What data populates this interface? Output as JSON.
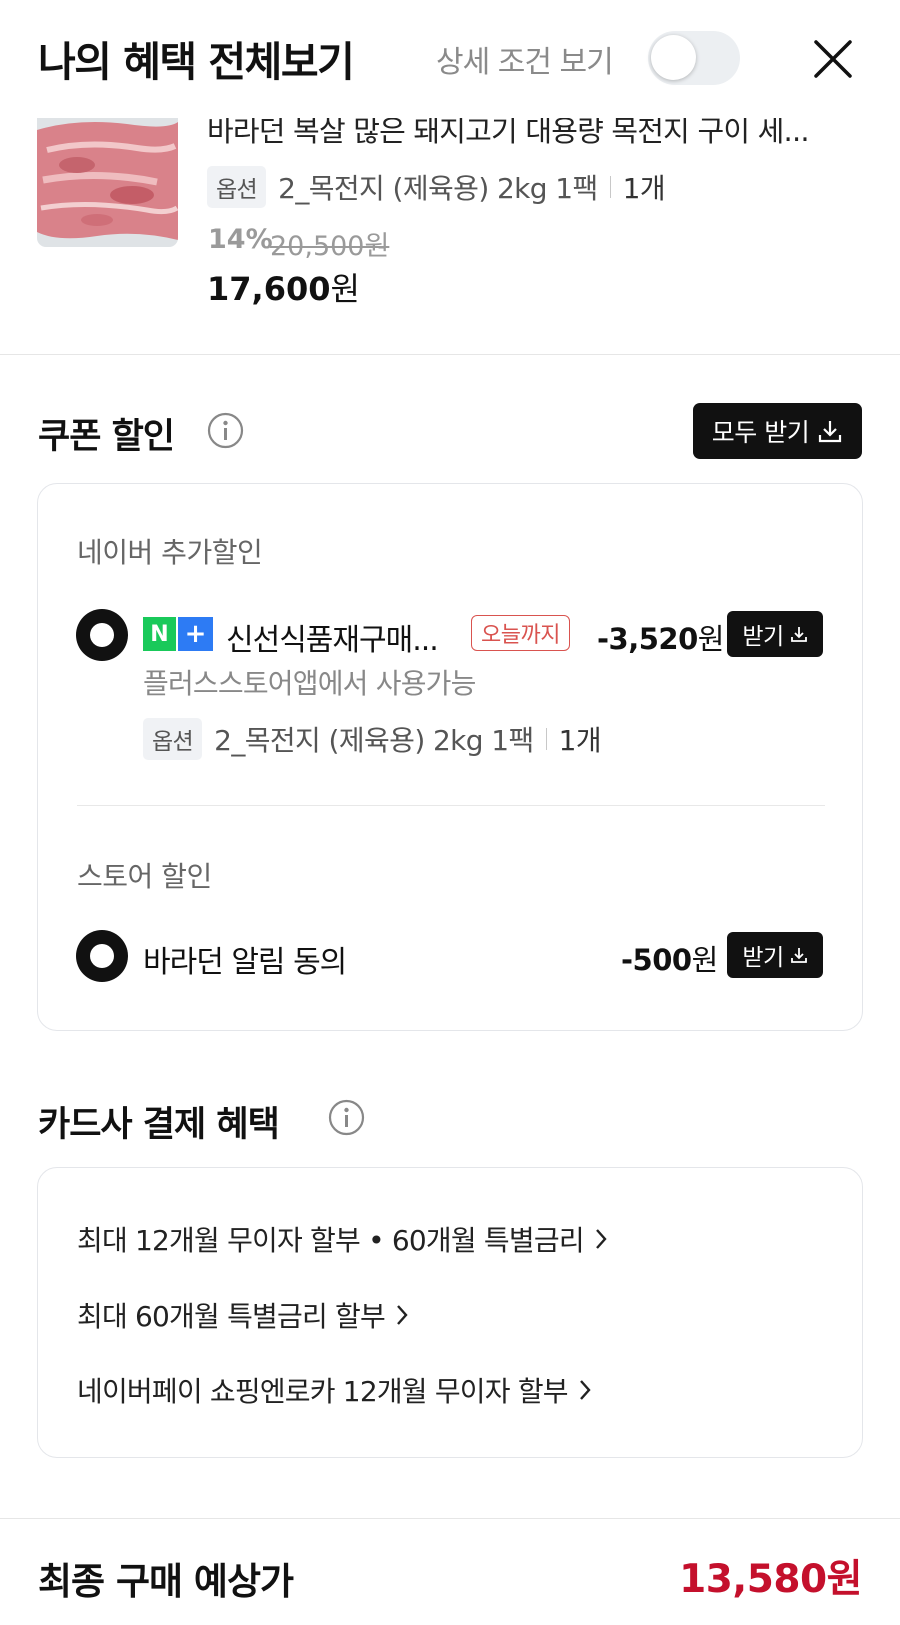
{
  "header": {
    "title": "나의 혜택 전체보기",
    "detail_toggle_label": "상세 조건 보기",
    "detail_toggle_on": false
  },
  "product": {
    "name": "바라던 복살 많은 돼지고기 대용량 목전지 구이 세...",
    "option_tag": "옵션",
    "option_value": "2_목전지 (제육용) 2kg 1팩",
    "quantity": "1개",
    "discount_rate": "14%",
    "original_price": "20,500원",
    "sale_price_number": "17,600",
    "sale_price_unit": "원"
  },
  "coupon_section": {
    "title": "쿠폰 할인",
    "get_all_label": "모두 받기",
    "naver": {
      "heading": "네이버 추가할인",
      "badge_n": "N",
      "badge_plus": "+",
      "coupon_name": "신선식품재구매...",
      "deadline_badge": "오늘까지",
      "amount_number": "-3,520",
      "amount_unit": "원",
      "receive_label": "받기",
      "usable_text": "플러스스토어앱에서 사용가능",
      "option_tag": "옵션",
      "option_value": "2_목전지 (제육용) 2kg 1팩",
      "quantity": "1개"
    },
    "store": {
      "heading": "스토어 할인",
      "coupon_name": "바라던 알림 동의",
      "amount_number": "-500",
      "amount_unit": "원",
      "receive_label": "받기"
    }
  },
  "card_section": {
    "title": "카드사 결제 혜택",
    "items": [
      "최대 12개월 무이자 할부 • 60개월 특별금리",
      "최대 60개월 특별금리 할부",
      "네이버페이 쇼핑엔로카 12개월 무이자 할부"
    ]
  },
  "footer": {
    "final_label": "최종 구매 예상가",
    "final_price": "13,580원"
  },
  "colors": {
    "accent_red": "#c4102c",
    "badge_red": "#d9534f",
    "n_green": "#19c95a",
    "plus_blue": "#2d7bf4"
  }
}
